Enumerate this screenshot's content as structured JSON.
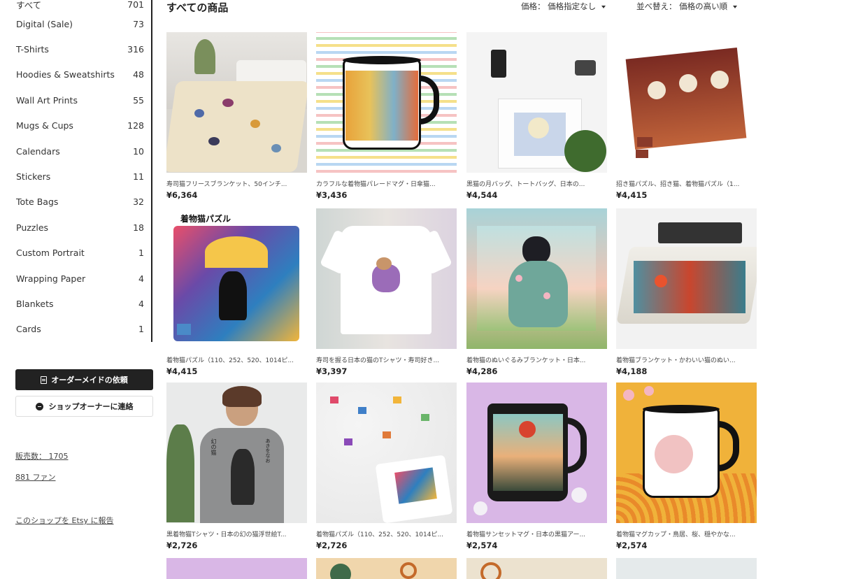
{
  "sidebar": {
    "categories": [
      {
        "label": "すべて",
        "count": "701"
      },
      {
        "label": "Digital (Sale)",
        "count": "73"
      },
      {
        "label": "T-Shirts",
        "count": "316"
      },
      {
        "label": "Hoodies & Sweatshirts",
        "count": "48"
      },
      {
        "label": "Wall Art Prints",
        "count": "55"
      },
      {
        "label": "Mugs & Cups",
        "count": "128"
      },
      {
        "label": "Calendars",
        "count": "10"
      },
      {
        "label": "Stickers",
        "count": "11"
      },
      {
        "label": "Tote Bags",
        "count": "32"
      },
      {
        "label": "Puzzles",
        "count": "18"
      },
      {
        "label": "Custom Portrait",
        "count": "1"
      },
      {
        "label": "Wrapping Paper",
        "count": "4"
      },
      {
        "label": "Blankets",
        "count": "4"
      },
      {
        "label": "Cards",
        "count": "1"
      }
    ],
    "custom_order_button": "オーダーメイドの依頼",
    "contact_owner_button": "ショップオーナーに連絡",
    "sales_link": "販売数： 1705",
    "fans_link": "881 ファン",
    "report_link": "このショップを Etsy に報告"
  },
  "header": {
    "title": "すべての商品",
    "price_filter": "価格： 価格指定なし",
    "sort": "並べ替え： 価格の高い順"
  },
  "products": [
    {
      "title": "寿司猫フリースブランケット、50インチ...",
      "price": "¥6,364"
    },
    {
      "title": "カラフルな着物猫パレードマグ・日傘猫...",
      "price": "¥3,436"
    },
    {
      "title": "黒猫の月バッグ、トートバッグ、日本の...",
      "price": "¥4,544"
    },
    {
      "title": "招き猫パズル、招き猫、着物猫パズル（1...",
      "price": "¥4,415"
    },
    {
      "title": "着物猫パズル（110、252、520、1014ピ...",
      "price": "¥4,415"
    },
    {
      "title": "寿司を握る日本の猫のTシャツ・寿司好き...",
      "price": "¥3,397"
    },
    {
      "title": "着物猫のぬいぐるみブランケット・日本...",
      "price": "¥4,286"
    },
    {
      "title": "着物猫ブランケット・かわいい猫のぬい...",
      "price": "¥4,188"
    },
    {
      "title": "黒着物猫Tシャツ・日本の幻の猫浮世絵T...",
      "price": "¥2,726"
    },
    {
      "title": "着物猫パズル（110、252、520、1014ピ...",
      "price": "¥2,726"
    },
    {
      "title": "着物猫サンセットマグ・日本の黒猫アー...",
      "price": "¥2,574"
    },
    {
      "title": "着物猫マグカップ・鳥居、桜、穏やかな...",
      "price": "¥2,574"
    }
  ],
  "image_text": {
    "puzzle_title": "着物猫パズル",
    "tshirt_kanji_left": "幻の猫",
    "tshirt_kanji_right": "あきをなお"
  },
  "colors": {
    "primary_button": "#222222",
    "page_bg": "#ffffff"
  }
}
